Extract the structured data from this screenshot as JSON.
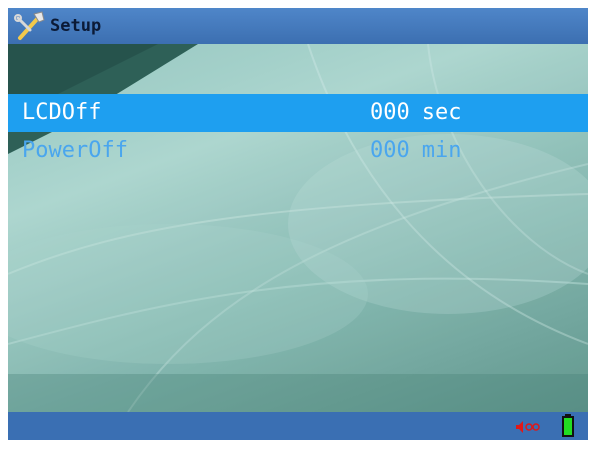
{
  "header": {
    "title": "Setup",
    "icon": "tools-icon"
  },
  "menu": {
    "items": [
      {
        "label": "LCDOff",
        "value": "000",
        "unit": "sec",
        "selected": true
      },
      {
        "label": "PowerOff",
        "value": "000",
        "unit": "min",
        "selected": false
      }
    ]
  },
  "status": {
    "sound_icon": "speaker-muted-icon",
    "battery_icon": "battery-icon"
  },
  "colors": {
    "header_bg": "#3c6fb1",
    "selection_bg": "#1e9ff0",
    "menu_text": "#4aa6ee",
    "battery": "#22dd22",
    "sound": "#e01818"
  }
}
